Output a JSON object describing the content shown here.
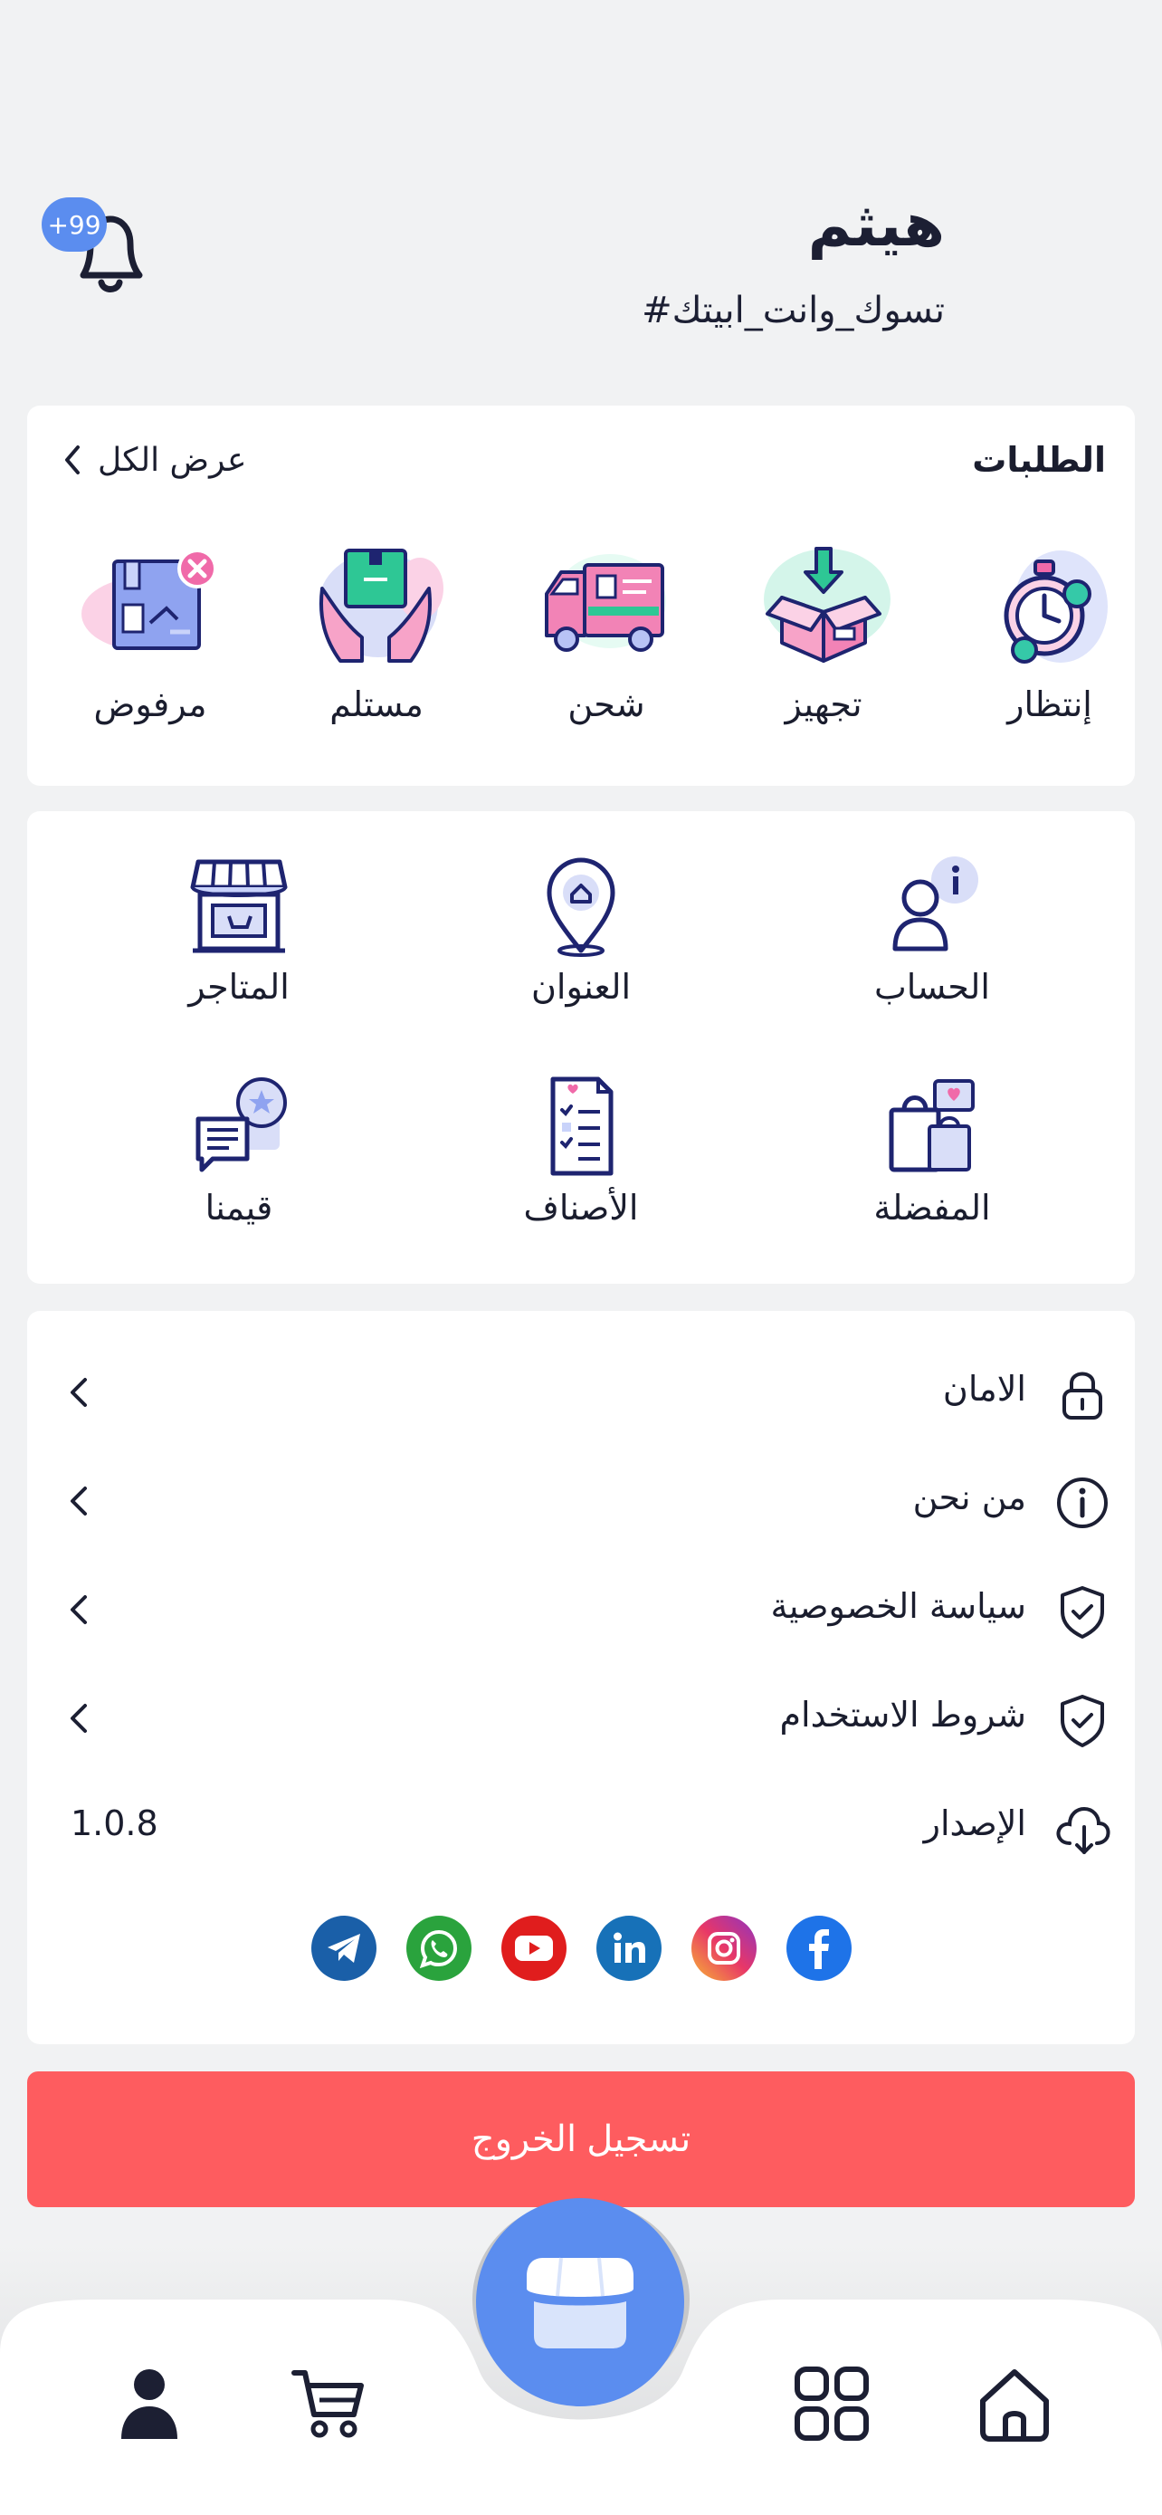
{
  "header": {
    "user_name": "هيثم",
    "user_tag": "#تسوك_وانت_ابيتك",
    "notification_count": "+99"
  },
  "orders": {
    "title": "الطلبات",
    "view_all": "عرض الكل",
    "statuses": [
      {
        "label": "إنتظار",
        "icon": "stopwatch-icon"
      },
      {
        "label": "تجهيز",
        "icon": "open-box-icon"
      },
      {
        "label": "شحن",
        "icon": "delivery-truck-icon"
      },
      {
        "label": "مستلم",
        "icon": "hands-package-icon"
      },
      {
        "label": "مرفوض",
        "icon": "rejected-box-icon"
      }
    ]
  },
  "shortcuts": [
    {
      "label": "الحساب",
      "icon": "account-icon"
    },
    {
      "label": "العنوان",
      "icon": "address-pin-icon"
    },
    {
      "label": "المتاجر",
      "icon": "store-icon"
    },
    {
      "label": "المفضلة",
      "icon": "favorites-bags-icon"
    },
    {
      "label": "الأصناف",
      "icon": "categories-list-icon"
    },
    {
      "label": "قيمنا",
      "icon": "rate-us-icon"
    }
  ],
  "settings": [
    {
      "label": "الامان",
      "icon": "lock-icon"
    },
    {
      "label": "من نحن",
      "icon": "info-icon"
    },
    {
      "label": "سياسة الخصوصية",
      "icon": "shield-check-icon"
    },
    {
      "label": "شروط الاستخدام",
      "icon": "shield-check-icon"
    }
  ],
  "version": {
    "label": "الإصدار",
    "value": "1.0.8",
    "icon": "cloud-download-icon"
  },
  "socials": [
    {
      "name": "telegram",
      "color": "#1a5fa8"
    },
    {
      "name": "whatsapp",
      "color": "#2aa33d"
    },
    {
      "name": "youtube",
      "color": "#e01d1d"
    },
    {
      "name": "linkedin",
      "color": "#1771b8"
    },
    {
      "name": "instagram",
      "color": "#c1358a"
    },
    {
      "name": "facebook",
      "color": "#1e73e8"
    }
  ],
  "logout_label": "تسجيل الخروج",
  "nav": [
    "profile-icon",
    "cart-icon",
    "store-fab-icon",
    "grid-icon",
    "home-icon"
  ],
  "colors": {
    "accent": "#5b8def",
    "logout": "#fe5c5f",
    "dark": "#1c1f33"
  }
}
